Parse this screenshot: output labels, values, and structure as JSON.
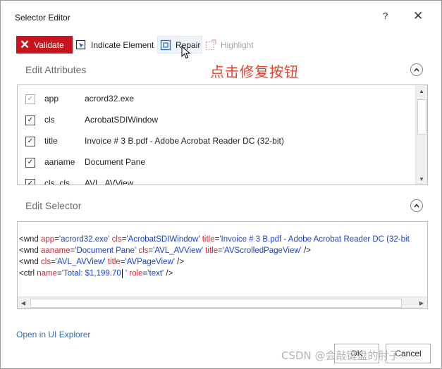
{
  "window": {
    "title": "Selector Editor",
    "help": "?",
    "close": "✕"
  },
  "toolbar": {
    "validate": "Validate",
    "indicate": "Indicate Element",
    "repair": "Repair",
    "highlight": "Highlight"
  },
  "annotation": "点击修复按钮",
  "edit_attributes": {
    "heading": "Edit Attributes",
    "rows": [
      {
        "name": "app",
        "value": "acrord32.exe",
        "checked": true,
        "enabled": false
      },
      {
        "name": "cls",
        "value": "AcrobatSDIWindow",
        "checked": true,
        "enabled": true
      },
      {
        "name": "title",
        "value": "Invoice # 3 B.pdf - Adobe Acrobat Reader DC (32-bit)",
        "checked": true,
        "enabled": true
      },
      {
        "name": "aaname",
        "value": "Document Pane",
        "checked": true,
        "enabled": true
      },
      {
        "name": "cls_cls",
        "value": "AVL_AVView",
        "checked": true,
        "enabled": true
      }
    ]
  },
  "edit_selector": {
    "heading": "Edit Selector",
    "lines": [
      [
        {
          "k": "t",
          "s": "<wnd "
        },
        {
          "k": "a",
          "s": "app"
        },
        {
          "k": "t",
          "s": "="
        },
        {
          "k": "v",
          "s": "'acrord32.exe'"
        },
        {
          "k": "t",
          "s": " "
        },
        {
          "k": "a",
          "s": "cls"
        },
        {
          "k": "t",
          "s": "="
        },
        {
          "k": "v",
          "s": "'AcrobatSDIWindow'"
        },
        {
          "k": "t",
          "s": " "
        },
        {
          "k": "a",
          "s": "title"
        },
        {
          "k": "t",
          "s": "="
        },
        {
          "k": "v",
          "s": "'Invoice # 3 B.pdf - Adobe Acrobat Reader DC (32-bit"
        }
      ],
      [
        {
          "k": "t",
          "s": "<wnd "
        },
        {
          "k": "a",
          "s": "aaname"
        },
        {
          "k": "t",
          "s": "="
        },
        {
          "k": "v",
          "s": "'Document Pane'"
        },
        {
          "k": "t",
          "s": " "
        },
        {
          "k": "a",
          "s": "cls"
        },
        {
          "k": "t",
          "s": "="
        },
        {
          "k": "v",
          "s": "'AVL_AVView'"
        },
        {
          "k": "t",
          "s": " "
        },
        {
          "k": "a",
          "s": "title"
        },
        {
          "k": "t",
          "s": "="
        },
        {
          "k": "v",
          "s": "'AVScrolledPageView'"
        },
        {
          "k": "t",
          "s": " />"
        }
      ],
      [
        {
          "k": "t",
          "s": "<wnd "
        },
        {
          "k": "a",
          "s": "cls"
        },
        {
          "k": "t",
          "s": "="
        },
        {
          "k": "v",
          "s": "'AVL_AVView'"
        },
        {
          "k": "t",
          "s": " "
        },
        {
          "k": "a",
          "s": "title"
        },
        {
          "k": "t",
          "s": "="
        },
        {
          "k": "v",
          "s": "'AVPageView'"
        },
        {
          "k": "t",
          "s": " />"
        }
      ],
      [
        {
          "k": "t",
          "s": "<ctrl "
        },
        {
          "k": "a",
          "s": "name"
        },
        {
          "k": "t",
          "s": "="
        },
        {
          "k": "v",
          "s": "'Total:   $1,199.70"
        },
        {
          "k": "c",
          "s": ""
        },
        {
          "k": "v",
          "s": " '"
        },
        {
          "k": "t",
          "s": " "
        },
        {
          "k": "a",
          "s": "role"
        },
        {
          "k": "t",
          "s": "="
        },
        {
          "k": "v",
          "s": "'text'"
        },
        {
          "k": "t",
          "s": " />"
        }
      ]
    ]
  },
  "footer": {
    "link": "Open in UI Explorer",
    "ok": "OK",
    "cancel": "Cancel"
  },
  "watermark": "CSDN @会敲键盘的肘子",
  "colors": {
    "validate_bg": "#c8141c",
    "annotation": "#e8412a",
    "link": "#2a6fbf",
    "attr": "#e0202e",
    "value": "#1a3fd6",
    "tag": "#8b1b2f"
  }
}
